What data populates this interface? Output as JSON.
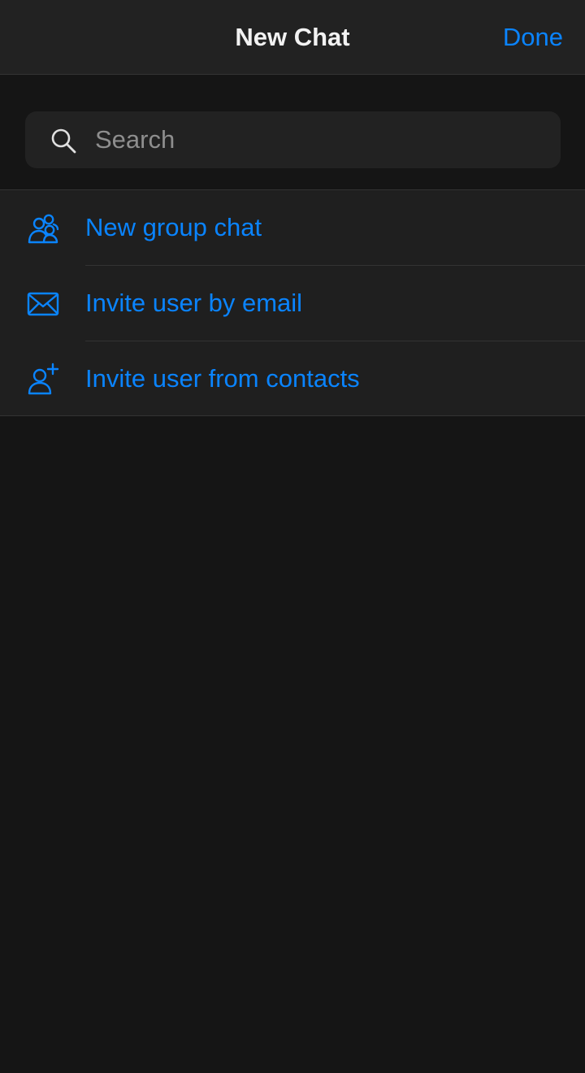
{
  "navbar": {
    "title": "New Chat",
    "done_label": "Done"
  },
  "search": {
    "placeholder": "Search",
    "value": "",
    "icon": "search-icon"
  },
  "menu": {
    "items": [
      {
        "label": "New group chat",
        "icon": "group-icon"
      },
      {
        "label": "Invite user by email",
        "icon": "envelope-icon"
      },
      {
        "label": "Invite user from contacts",
        "icon": "add-user-icon"
      }
    ]
  },
  "colors": {
    "accent": "#0a84ff",
    "background": "#151515",
    "surface": "#222222",
    "list_surface": "#1f1f1f",
    "title_text": "#f2f2f2",
    "placeholder_text": "#8e8e8e",
    "divider": "#333333"
  }
}
